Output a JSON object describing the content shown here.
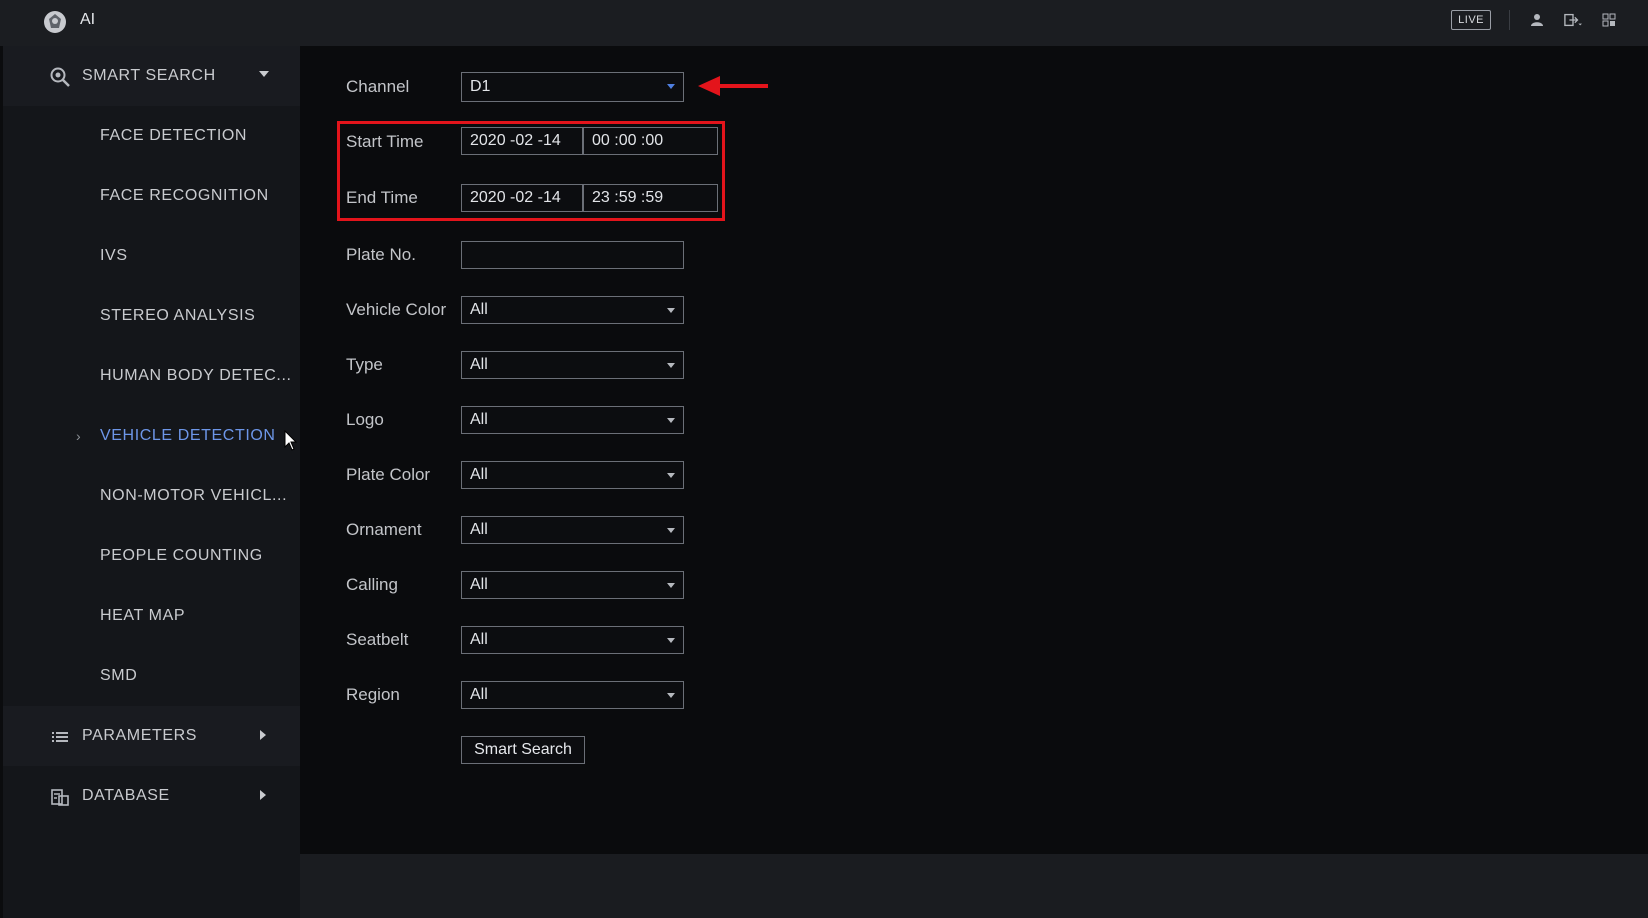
{
  "app": {
    "title": "AI",
    "live_label": "LIVE"
  },
  "colors": {
    "accent": "#6d96e8",
    "highlight": "#e3141b",
    "background": "#0a0b0d"
  },
  "icons": {
    "logo": "ai-logo-icon",
    "user": "user-icon",
    "logout": "logout-icon",
    "grid": "grid-icon",
    "smart_search": "smart-search-icon",
    "parameters": "list-icon",
    "database": "database-icon"
  },
  "sidebar": {
    "smart_search": "SMART SEARCH",
    "items": [
      "FACE DETECTION",
      "FACE RECOGNITION",
      "IVS",
      "STEREO ANALYSIS",
      "HUMAN BODY DETEC...",
      "VEHICLE DETECTION",
      "NON-MOTOR VEHICL...",
      "PEOPLE COUNTING",
      "HEAT MAP",
      "SMD"
    ],
    "active_item": "VEHICLE DETECTION",
    "parameters": "PARAMETERS",
    "database": "DATABASE"
  },
  "form": {
    "channel": {
      "label": "Channel",
      "value": "D1"
    },
    "start_time": {
      "label": "Start Time",
      "date": "2020 -02 -14",
      "time": "00 :00 :00"
    },
    "end_time": {
      "label": "End Time",
      "date": "2020 -02 -14",
      "time": "23 :59 :59"
    },
    "plate_no": {
      "label": "Plate No.",
      "value": ""
    },
    "vehicle_color": {
      "label": "Vehicle Color",
      "value": "All"
    },
    "type": {
      "label": "Type",
      "value": "All"
    },
    "logo": {
      "label": "Logo",
      "value": "All"
    },
    "plate_color": {
      "label": "Plate Color",
      "value": "All"
    },
    "ornament": {
      "label": "Ornament",
      "value": "All"
    },
    "calling": {
      "label": "Calling",
      "value": "All"
    },
    "seatbelt": {
      "label": "Seatbelt",
      "value": "All"
    },
    "region": {
      "label": "Region",
      "value": "All"
    },
    "search_button": "Smart Search"
  }
}
